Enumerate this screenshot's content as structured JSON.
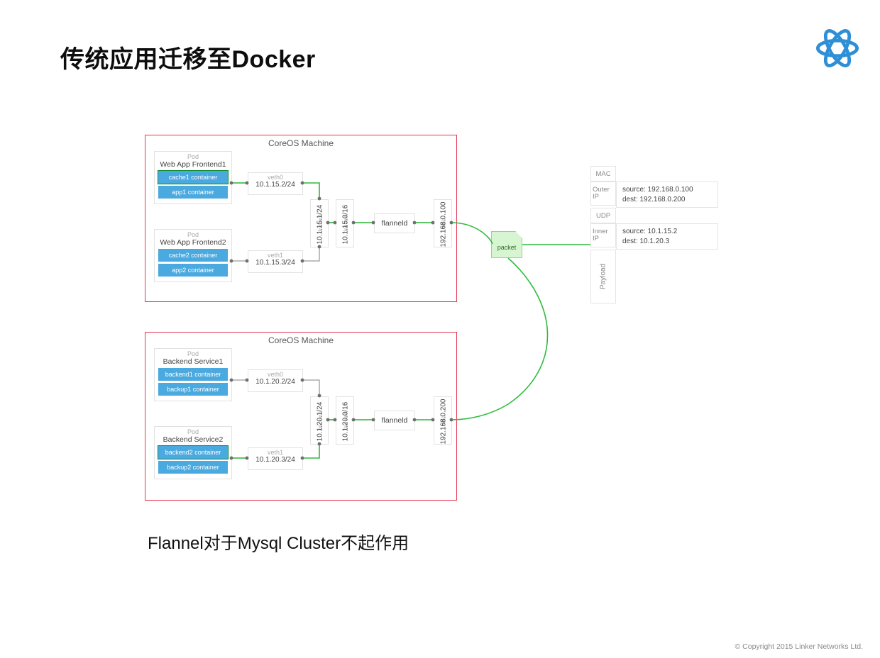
{
  "title": "传统应用迁移至Docker",
  "logo_name": "linker-logo",
  "copyright": "© Copyright 2015 Linker Networks Ltd.",
  "caption": "Flannel对于Mysql Cluster不起作用",
  "machine1": {
    "title": "CoreOS Machine",
    "pod1": {
      "label": "Pod",
      "name": "Web App Frontend1",
      "c1": "cache1 container",
      "c2": "app1 container"
    },
    "pod2": {
      "label": "Pod",
      "name": "Web App Frontend2",
      "c1": "cache2 container",
      "c2": "app2 container"
    },
    "veth0": {
      "lbl": "veth0",
      "ip": "10.1.15.2/24"
    },
    "veth1": {
      "lbl": "veth1",
      "ip": "10.1.15.3/24"
    },
    "docker0": {
      "lbl": "docker0",
      "ip": "10.1.15.1/24"
    },
    "flannel0": {
      "lbl": "flannel0",
      "ip": "10.1.15.0/16"
    },
    "flanneld": "flanneld",
    "eth0": {
      "lbl": "eth0",
      "ip": "192.168.0.100"
    }
  },
  "machine2": {
    "title": "CoreOS Machine",
    "pod1": {
      "label": "Pod",
      "name": "Backend Service1",
      "c1": "backend1 container",
      "c2": "backup1 container"
    },
    "pod2": {
      "label": "Pod",
      "name": "Backend Service2",
      "c1": "backend2 container",
      "c2": "backup2 container"
    },
    "veth0": {
      "lbl": "veth0",
      "ip": "10.1.20.2/24"
    },
    "veth1": {
      "lbl": "veth1",
      "ip": "10.1.20.3/24"
    },
    "docker0": {
      "lbl": "docker0",
      "ip": "10.1.20.1/24"
    },
    "flannel0": {
      "lbl": "flannel0",
      "ip": "10.1.20.0/16"
    },
    "flanneld": "flanneld",
    "eth0": {
      "lbl": "eth0",
      "ip": "192.168.0.200"
    }
  },
  "packet": "packet",
  "pstack": {
    "mac": "MAC",
    "outer_ip_lbl": "Outer IP",
    "outer_ip_src": "source: 192.168.0.100",
    "outer_ip_dst": "dest: 192.168.0.200",
    "udp": "UDP",
    "inner_ip_lbl": "Inner IP",
    "inner_ip_src": "source: 10.1.15.2",
    "inner_ip_dst": "dest: 10.1.20.3",
    "payload": "Payload"
  }
}
